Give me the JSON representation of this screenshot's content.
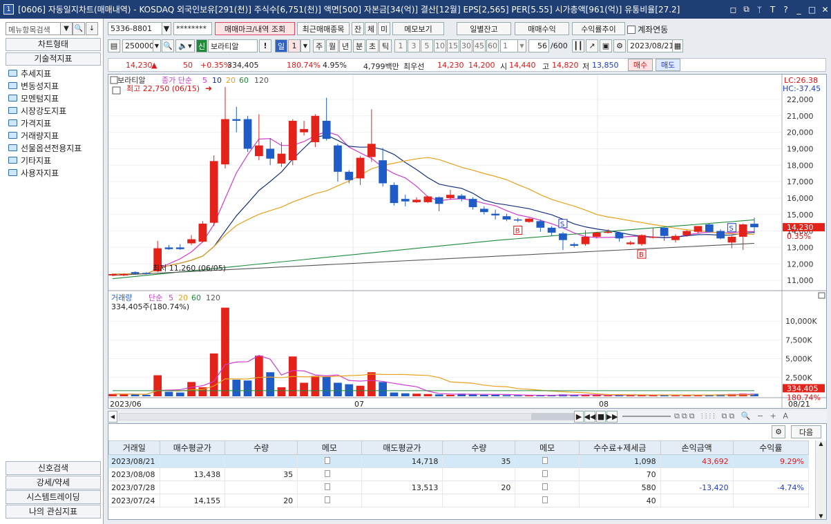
{
  "window": {
    "app_icon": "1",
    "title": "[0606] 자동일지차트(매매내역) - KOSDAQ 외국인보유[291(천)] 주식수[6,751(천)] 액면[500] 자본금[34(억)] 결산[12월] EPS[2,565] PER[5.55] 시가총액[961(억)] 유통비율[27.2]",
    "controls": [
      "◻",
      "⧉",
      "ᛘ",
      "T",
      "?",
      "_",
      "□",
      "✕"
    ]
  },
  "sidebar": {
    "search_placeholder": "메뉴항목검색",
    "tabs": [
      "차트형태",
      "기술적지표"
    ],
    "items": [
      "추세지표",
      "변동성지표",
      "모멘텀지표",
      "시장강도지표",
      "가격지표",
      "거래량지표",
      "선물옵션전용지표",
      "기타지표",
      "사용자지표"
    ],
    "bottom": [
      "신호검색",
      "강세/약세",
      "시스템트레이딩",
      "나의 관심지표"
    ]
  },
  "toolbar1": {
    "account": "5336-8801",
    "password": "********",
    "btn_mark": "매매마크/내역 조회",
    "btn_recent": "최근매매종목",
    "btn_jan": "잔",
    "btn_che": "체",
    "btn_mi": "미",
    "btn_memo": "메모보기",
    "btn_daily": "일별잔고",
    "btn_profit": "매매수익",
    "btn_trend": "수익률추이",
    "chk_link": "계좌연동"
  },
  "toolbar2": {
    "code": "250000",
    "sin": "신",
    "name": "보라티알",
    "period_day": "일",
    "period_n": "1",
    "periods": [
      "주",
      "월",
      "년",
      "분",
      "초",
      "틱"
    ],
    "nums": [
      "1",
      "3",
      "5",
      "10",
      "15",
      "30",
      "45",
      "60"
    ],
    "n_sel": "1",
    "count": "56",
    "count_max": "/600",
    "date": "2023/08/21"
  },
  "info": {
    "price": "14,230",
    "arrow": "▲",
    "change": "50",
    "rate": "+0.35%",
    "volume": "334,405",
    "vol_rate": "180.74%",
    "turnover": "4.95%",
    "amount": "4,799백만",
    "best_label": "최우선",
    "ask": "14,230",
    "bid": "14,200",
    "open_label": "시",
    "open": "14,440",
    "high_label": "고",
    "high": "14,820",
    "low_label": "저",
    "low": "13,850",
    "buy": "매수",
    "sell": "매도"
  },
  "chart_data": {
    "type": "candlestick",
    "legend_price": {
      "name": "보라티알",
      "ma_label": "종가 단순",
      "ma": [
        "5",
        "10",
        "20",
        "60",
        "120"
      ]
    },
    "legend_volume": {
      "name": "거래량",
      "ma_label": "단순",
      "ma": [
        "5",
        "20",
        "60",
        "120"
      ],
      "current": "334,405주(180.74%)"
    },
    "annot_high": "최고 22,750 (06/15)",
    "annot_low": "최저 11,260 (06/05)",
    "lc": "LC:26.38",
    "hc": "HC:-37.45",
    "price_axis": [
      "22,000",
      "21,000",
      "20,000",
      "19,000",
      "18,000",
      "17,000",
      "16,000",
      "15,000",
      "14,000",
      "13,000",
      "12,000",
      "11,000"
    ],
    "price_label": "14,230",
    "rate_label": "0.35%",
    "vol_axis": [
      "10,000K",
      "7,500K",
      "5,000K",
      "2,500K"
    ],
    "vol_label": "334,405",
    "vol_rate_label": "180.74%",
    "x_labels": [
      "2023/06",
      "07",
      "08"
    ],
    "x_last": "08/21",
    "ylim": [
      10500,
      23300
    ],
    "candles": [
      {
        "o": 11300,
        "c": 11380,
        "h": 11420,
        "l": 11260,
        "v": 300
      },
      {
        "o": 11300,
        "c": 11380,
        "h": 11420,
        "l": 11260,
        "v": 300
      },
      {
        "o": 11500,
        "c": 11400,
        "h": 11550,
        "l": 11350,
        "v": 250
      },
      {
        "o": 11450,
        "c": 11400,
        "h": 11500,
        "l": 11360,
        "v": 200
      },
      {
        "o": 11550,
        "c": 12950,
        "h": 13400,
        "l": 11500,
        "v": 2800
      },
      {
        "o": 13000,
        "c": 12900,
        "h": 13150,
        "l": 12850,
        "v": 600
      },
      {
        "o": 13000,
        "c": 12900,
        "h": 13200,
        "l": 12850,
        "v": 500
      },
      {
        "o": 13250,
        "c": 13500,
        "h": 13750,
        "l": 13150,
        "v": 1900
      },
      {
        "o": 13350,
        "c": 14450,
        "h": 14600,
        "l": 13300,
        "v": 1200
      },
      {
        "o": 14500,
        "c": 18250,
        "h": 18600,
        "l": 14300,
        "v": 5700
      },
      {
        "o": 18050,
        "c": 20800,
        "h": 22750,
        "l": 17800,
        "v": 11800
      },
      {
        "o": 20800,
        "c": 20700,
        "h": 21550,
        "l": 20000,
        "v": 2200
      },
      {
        "o": 20800,
        "c": 19000,
        "h": 21000,
        "l": 18800,
        "v": 2100
      },
      {
        "o": 18550,
        "c": 19200,
        "h": 21100,
        "l": 18300,
        "v": 5400
      },
      {
        "o": 19000,
        "c": 18400,
        "h": 19650,
        "l": 18000,
        "v": 3200
      },
      {
        "o": 18100,
        "c": 18700,
        "h": 19400,
        "l": 17900,
        "v": 1200
      },
      {
        "o": 18300,
        "c": 20700,
        "h": 20800,
        "l": 18000,
        "v": 5300
      },
      {
        "o": 20000,
        "c": 20200,
        "h": 20700,
        "l": 19800,
        "v": 1800
      },
      {
        "o": 19400,
        "c": 21000,
        "h": 21100,
        "l": 19100,
        "v": 2700
      },
      {
        "o": 20700,
        "c": 19600,
        "h": 22100,
        "l": 19500,
        "v": 2600
      },
      {
        "o": 19200,
        "c": 17600,
        "h": 19300,
        "l": 17000,
        "v": 1800
      },
      {
        "o": 17600,
        "c": 17100,
        "h": 17700,
        "l": 16900,
        "v": 1600
      },
      {
        "o": 17200,
        "c": 18450,
        "h": 18550,
        "l": 16800,
        "v": 1400
      },
      {
        "o": 18500,
        "c": 19300,
        "h": 21400,
        "l": 18200,
        "v": 3200
      },
      {
        "o": 18300,
        "c": 16900,
        "h": 19050,
        "l": 16700,
        "v": 1900
      },
      {
        "o": 16800,
        "c": 15700,
        "h": 16950,
        "l": 15550,
        "v": 500
      },
      {
        "o": 15950,
        "c": 15800,
        "h": 16200,
        "l": 15500,
        "v": 400
      },
      {
        "o": 15750,
        "c": 15900,
        "h": 16050,
        "l": 15700,
        "v": 350
      },
      {
        "o": 15750,
        "c": 16100,
        "h": 16150,
        "l": 15700,
        "v": 300
      },
      {
        "o": 16050,
        "c": 15650,
        "h": 16100,
        "l": 15200,
        "v": 250
      },
      {
        "o": 16000,
        "c": 16200,
        "h": 16500,
        "l": 15900,
        "v": 200
      },
      {
        "o": 16150,
        "c": 15950,
        "h": 16250,
        "l": 15800,
        "v": 350
      },
      {
        "o": 15950,
        "c": 15450,
        "h": 16050,
        "l": 15300,
        "v": 300
      },
      {
        "o": 15350,
        "c": 15150,
        "h": 15500,
        "l": 15000,
        "v": 200
      },
      {
        "o": 15050,
        "c": 14950,
        "h": 15300,
        "l": 14700,
        "v": 200
      },
      {
        "o": 14900,
        "c": 14700,
        "h": 15050,
        "l": 14600,
        "v": 150
      },
      {
        "o": 14700,
        "c": 14650,
        "h": 14800,
        "l": 14550,
        "v": 120
      },
      {
        "o": 14550,
        "c": 14750,
        "h": 14800,
        "l": 14500,
        "v": 100
      },
      {
        "o": 14600,
        "c": 14200,
        "h": 14700,
        "l": 13950,
        "v": 150
      },
      {
        "o": 14200,
        "c": 13900,
        "h": 14300,
        "l": 13700,
        "v": 180
      },
      {
        "o": 13850,
        "c": 13450,
        "h": 13950,
        "l": 12850,
        "v": 250
      },
      {
        "o": 13200,
        "c": 13100,
        "h": 13300,
        "l": 13000,
        "v": 180
      },
      {
        "o": 13200,
        "c": 13650,
        "h": 14050,
        "l": 13100,
        "v": 200
      },
      {
        "o": 13650,
        "c": 13900,
        "h": 13950,
        "l": 13550,
        "v": 160
      },
      {
        "o": 13900,
        "c": 13950,
        "h": 14100,
        "l": 13850,
        "v": 120
      },
      {
        "o": 13900,
        "c": 13550,
        "h": 13950,
        "l": 13350,
        "v": 150
      },
      {
        "o": 13200,
        "c": 13300,
        "h": 13400,
        "l": 13150,
        "v": 180
      },
      {
        "o": 13200,
        "c": 13750,
        "h": 13800,
        "l": 13100,
        "v": 220
      },
      {
        "o": 13650,
        "c": 13650,
        "h": 14200,
        "l": 13550,
        "v": 150
      },
      {
        "o": 14200,
        "c": 13700,
        "h": 14200,
        "l": 13400,
        "v": 180
      },
      {
        "o": 13450,
        "c": 13700,
        "h": 13800,
        "l": 13300,
        "v": 120
      },
      {
        "o": 13750,
        "c": 14000,
        "h": 14050,
        "l": 13650,
        "v": 200
      },
      {
        "o": 13950,
        "c": 14300,
        "h": 14300,
        "l": 13850,
        "v": 150
      },
      {
        "o": 14400,
        "c": 13950,
        "h": 14450,
        "l": 13900,
        "v": 220
      },
      {
        "o": 14000,
        "c": 13550,
        "h": 14100,
        "l": 13500,
        "v": 250
      },
      {
        "o": 13300,
        "c": 13650,
        "h": 13700,
        "l": 12950,
        "v": 300
      },
      {
        "o": 13650,
        "c": 14400,
        "h": 14450,
        "l": 12850,
        "v": 350
      },
      {
        "o": 14440,
        "c": 14230,
        "h": 14820,
        "l": 13850,
        "v": 334
      }
    ],
    "marks": [
      {
        "i": 36,
        "t": "B",
        "side": "buy"
      },
      {
        "i": 40,
        "t": "S",
        "side": "sell"
      },
      {
        "i": 47,
        "t": "B",
        "side": "buy"
      },
      {
        "i": 55,
        "t": "S",
        "side": "sell"
      }
    ],
    "colors": {
      "up": "#e3221a",
      "down": "#1f5cc7",
      "ma5": "#d13ad1",
      "ma10": "#17307e",
      "ma20": "#e8a11b",
      "ma60": "#1e8a3a",
      "ma120": "#555555"
    }
  },
  "scroll": {
    "buttons": [
      "▶",
      "◀◀",
      "■",
      "▶▶"
    ]
  },
  "grid": {
    "next": "다음",
    "headers": [
      "거래일",
      "매수평균가",
      "수량",
      "메모",
      "매도평균가",
      "수량",
      "메모",
      "수수료+제세금",
      "손익금액",
      "수익률"
    ],
    "rows": [
      [
        "2023/08/21",
        "",
        "",
        "",
        "14,718",
        "35",
        "",
        "1,098",
        "43,692",
        "9.29%"
      ],
      [
        "2023/08/08",
        "13,438",
        "35",
        "",
        "",
        "",
        "",
        "70",
        "",
        ""
      ],
      [
        "2023/07/28",
        "",
        "",
        "",
        "13,513",
        "20",
        "",
        "580",
        "-13,420",
        "-4.74%"
      ],
      [
        "2023/07/24",
        "14,155",
        "20",
        "",
        "",
        "",
        "",
        "40",
        "",
        ""
      ]
    ]
  }
}
